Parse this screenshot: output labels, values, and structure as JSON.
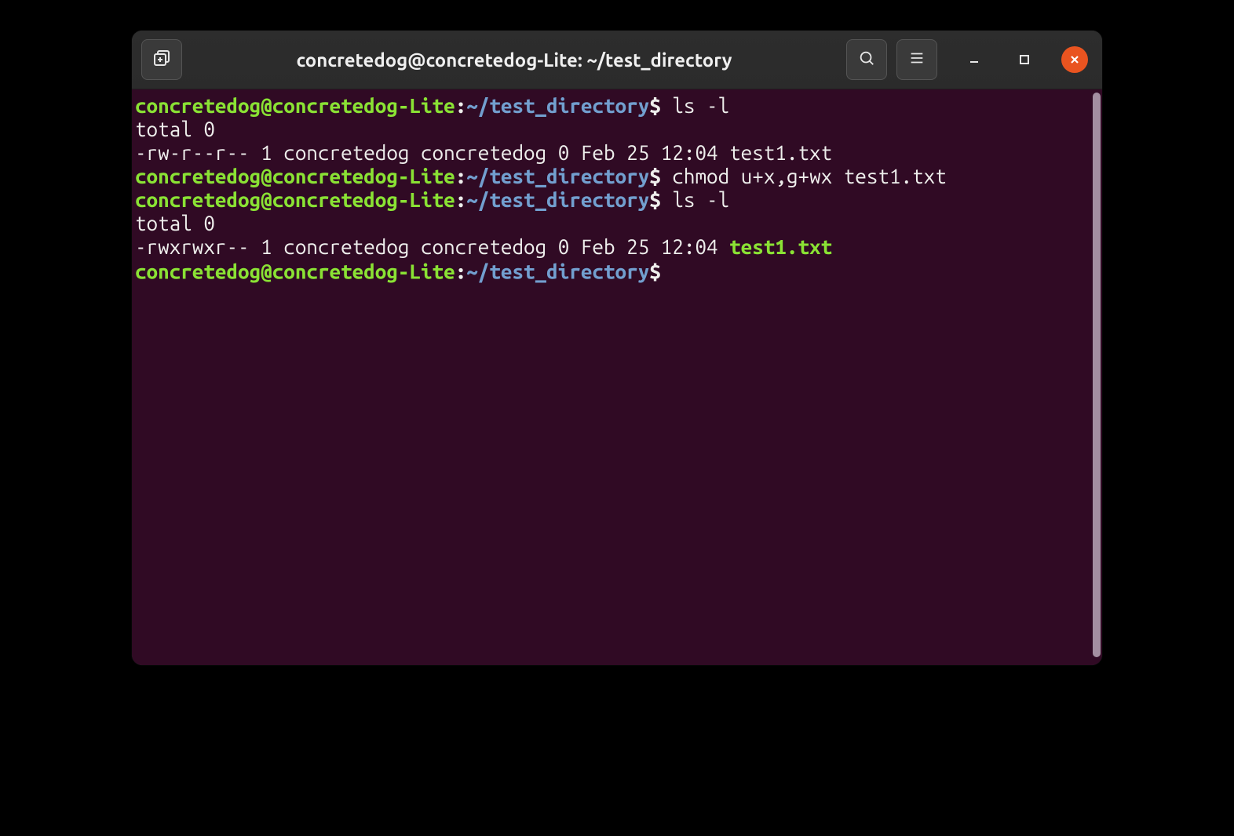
{
  "titlebar": {
    "title": "concretedog@concretedog-Lite: ~/test_directory"
  },
  "prompt": {
    "userhost": "concretedog@concretedog-Lite",
    "colon": ":",
    "path": "~/test_directory",
    "dollar": "$"
  },
  "lines": [
    {
      "type": "prompt",
      "cmd": "ls -l"
    },
    {
      "type": "output",
      "text": "total 0"
    },
    {
      "type": "output",
      "text": "-rw-r--r-- 1 concretedog concretedog 0 Feb 25 12:04 test1.txt"
    },
    {
      "type": "prompt",
      "cmd": "chmod u+x,g+wx test1.txt"
    },
    {
      "type": "prompt",
      "cmd": "ls -l"
    },
    {
      "type": "output",
      "text": "total 0"
    },
    {
      "type": "output_exec",
      "prefix": "-rwxrwxr-- 1 concretedog concretedog 0 Feb 25 12:04 ",
      "exec": "test1.txt"
    },
    {
      "type": "prompt",
      "cmd": ""
    }
  ]
}
